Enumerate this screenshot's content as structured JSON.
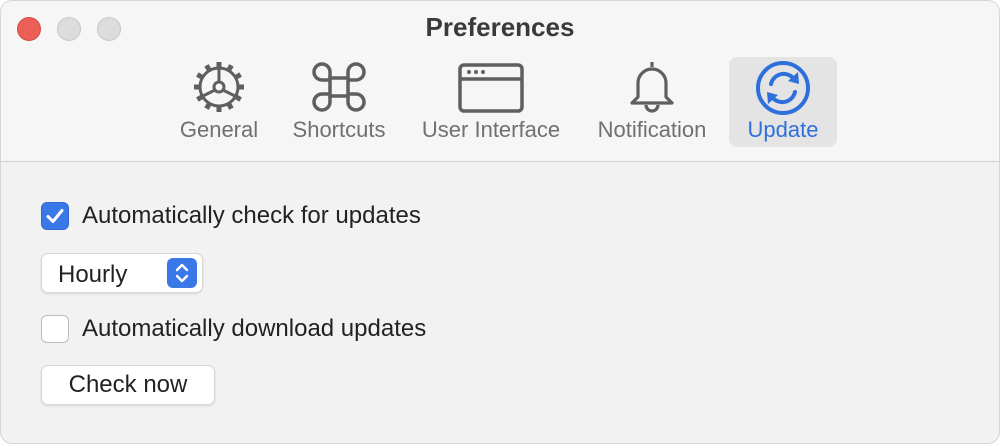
{
  "window": {
    "title": "Preferences"
  },
  "tabs": [
    {
      "label": "General",
      "icon": "gear-icon"
    },
    {
      "label": "Shortcuts",
      "icon": "command-key-icon"
    },
    {
      "label": "User Interface",
      "icon": "window-icon"
    },
    {
      "label": "Notification",
      "icon": "bell-icon"
    },
    {
      "label": "Update",
      "icon": "sync-icon",
      "selected": true
    }
  ],
  "update": {
    "auto_check": {
      "label": "Automatically check for updates",
      "checked": true
    },
    "frequency": {
      "value": "Hourly"
    },
    "auto_download": {
      "label": "Automatically download updates",
      "checked": false
    },
    "check_now_label": "Check now"
  },
  "colors": {
    "accent": "#3a78e8",
    "close": "#ec5f57",
    "selected_label": "#2f6fdc"
  }
}
